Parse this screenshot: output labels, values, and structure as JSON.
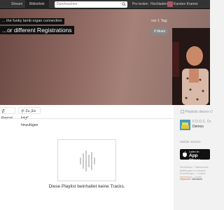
{
  "header": {
    "nav": [
      {
        "label": "Stream"
      },
      {
        "label": "Bibliothek"
      }
    ],
    "search_placeholder": "Durchsuchen",
    "try_pro": "Pro testen",
    "upload": "Hochladen",
    "username": "Karsten Kramer"
  },
  "hero": {
    "byline": "... the funky lamb organ connection",
    "title": "...or different Registrations",
    "time_ago": "vor 1 Tag",
    "tag": "# blues"
  },
  "actions": {
    "repost": "Repost",
    "add_to_queue": "Zu „Es folgt“ hinzufügen"
  },
  "empty_state": {
    "text": "Diese Playlist beinhaltet keine Tracks."
  },
  "sidebar": {
    "playlists_heading": "Playlists dieses U",
    "playlist_name": "F.O.O.C. Or",
    "playlist_sub": "Demos",
    "mobile_heading": "Mobile Version",
    "appstore_small": "Laden im",
    "appstore_big": "App Store",
    "footer_links": [
      "Rechtliches · Datenschutz",
      "Mitteilungen zu Inhalten",
      "Einstellungen · Cookies",
      "Impressum · Charts"
    ],
    "language_label": "Sprache:",
    "language_value": "Deutsch"
  },
  "colors": {
    "accent": "#ff5500",
    "topbar": "#333333",
    "hero_gradient": "#8d6760"
  },
  "icons": [
    "search-icon",
    "repost-icon",
    "queue-icon",
    "waveform-icon",
    "apple-icon",
    "playlist-icon"
  ]
}
